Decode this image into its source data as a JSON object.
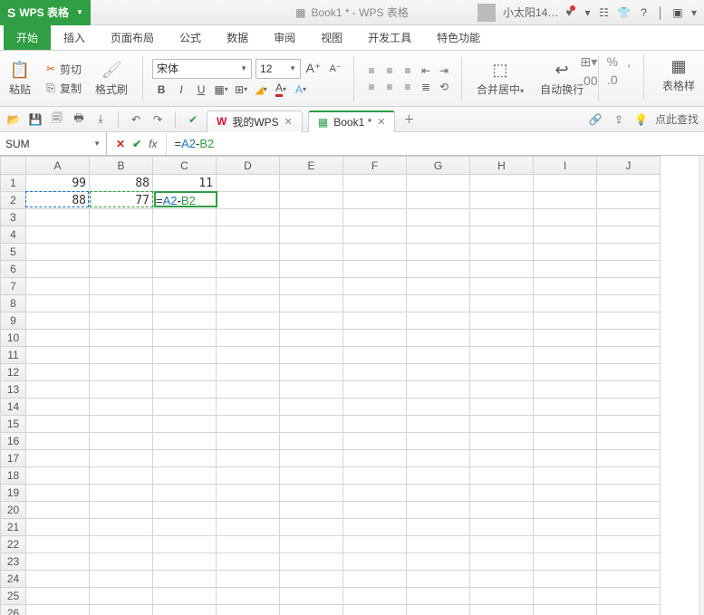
{
  "app": {
    "name": "WPS 表格",
    "doc_title": "Book1 * - WPS 表格"
  },
  "user": {
    "name": "小太阳14…"
  },
  "menu": {
    "items": [
      "开始",
      "插入",
      "页面布局",
      "公式",
      "数据",
      "审阅",
      "视图",
      "开发工具",
      "特色功能"
    ],
    "active": 0
  },
  "ribbon": {
    "paste": "粘贴",
    "cut": "剪切",
    "copy": "复制",
    "format_painter": "格式刷",
    "font_name": "宋体",
    "font_size": "12",
    "merge_center": "合并居中",
    "wrap": "自动换行",
    "cell_format": "表格样"
  },
  "qat": {
    "my_wps": "我的WPS",
    "book_tab": "Book1 *",
    "hint": "点此查找"
  },
  "formula": {
    "namebox": "SUM",
    "text_prefix": "=",
    "ref_a": "A2",
    "op": "-",
    "ref_b": "B2"
  },
  "columns": [
    "A",
    "B",
    "C",
    "D",
    "E",
    "F",
    "G",
    "H",
    "I",
    "J"
  ],
  "row_count": 26,
  "cells": {
    "A1": "99",
    "B1": "88",
    "C1": "11",
    "A2": "88",
    "B2": "77",
    "C2": "=A2-B2"
  },
  "active_cell": "C2",
  "selection_range": "A2:B2",
  "icons": {
    "percent": "%"
  }
}
